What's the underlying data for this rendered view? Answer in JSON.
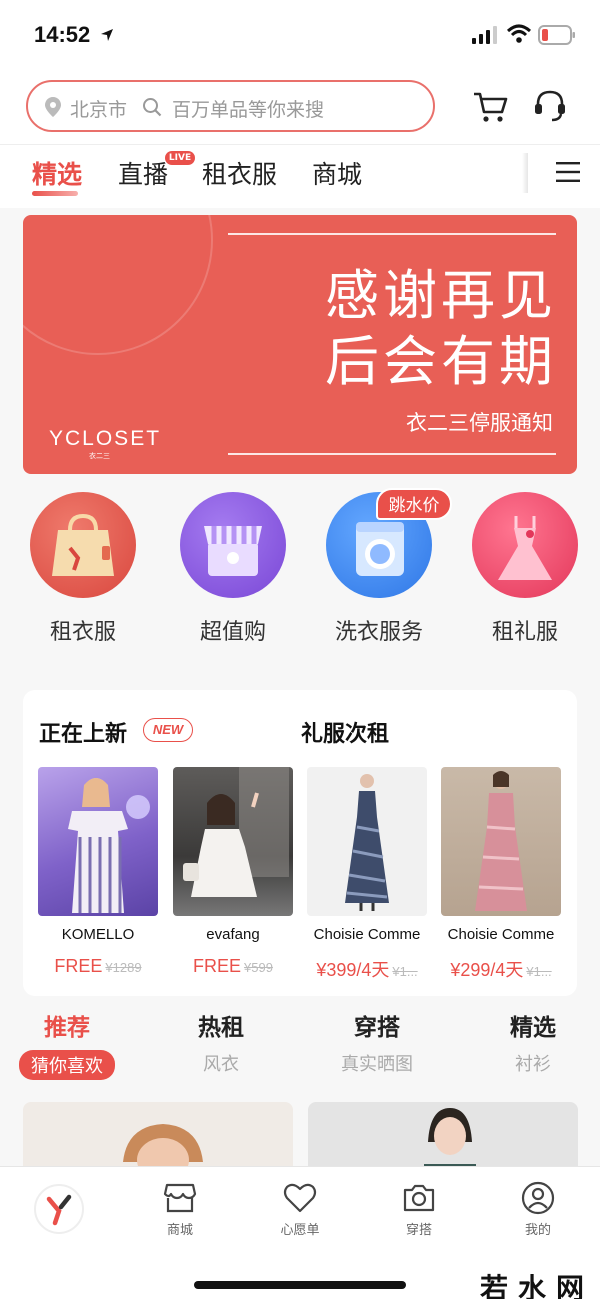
{
  "status_bar": {
    "time": "14:52"
  },
  "header": {
    "city": "北京市",
    "search_placeholder": "百万单品等你来搜"
  },
  "nav_tabs": [
    {
      "label": "精选",
      "active": true
    },
    {
      "label": "直播",
      "badge": "LIVE"
    },
    {
      "label": "租衣服"
    },
    {
      "label": "商城"
    }
  ],
  "banner": {
    "line1": "感谢再见",
    "line2": "后会有期",
    "subtitle": "衣二三停服通知",
    "logo": "YCLOSET",
    "logo_sub": "衣二三"
  },
  "categories": [
    {
      "label": "租衣服",
      "icon": "bag-icon",
      "color": "#e3564c"
    },
    {
      "label": "超值购",
      "icon": "store-icon",
      "color": "#8b5be0"
    },
    {
      "label": "洗衣服务",
      "icon": "washer-icon",
      "color": "#3f8bf0",
      "tag": "跳水价"
    },
    {
      "label": "租礼服",
      "icon": "dress-icon",
      "color": "#ee4f6b"
    }
  ],
  "new_arrivals": {
    "title": "正在上新",
    "badge": "NEW",
    "title2": "礼服次租",
    "products": [
      {
        "name": "KOMELLO",
        "price": "FREE",
        "old_price": "¥1289"
      },
      {
        "name": "evafang",
        "price": "FREE",
        "old_price": "¥599"
      },
      {
        "name": "Choisie Comme",
        "price": "¥399/4天",
        "old_price": "¥1..."
      },
      {
        "name": "Choisie Comme",
        "price": "¥299/4天",
        "old_price": "¥1..."
      }
    ]
  },
  "recommend_tabs": [
    {
      "title": "推荐",
      "sub": "猜你喜欢",
      "active": true
    },
    {
      "title": "热租",
      "sub": "风衣"
    },
    {
      "title": "穿搭",
      "sub": "真实晒图"
    },
    {
      "title": "精选",
      "sub": "衬衫"
    }
  ],
  "tab_bar": [
    {
      "label": "",
      "icon": "ycloset-logo-icon"
    },
    {
      "label": "商城",
      "icon": "store-icon"
    },
    {
      "label": "心愿单",
      "icon": "heart-icon"
    },
    {
      "label": "穿搭",
      "icon": "camera-icon"
    },
    {
      "label": "我的",
      "icon": "profile-icon"
    }
  ],
  "watermark": "若水网",
  "colors": {
    "accent": "#e9504a",
    "banner": "#e85f56"
  }
}
